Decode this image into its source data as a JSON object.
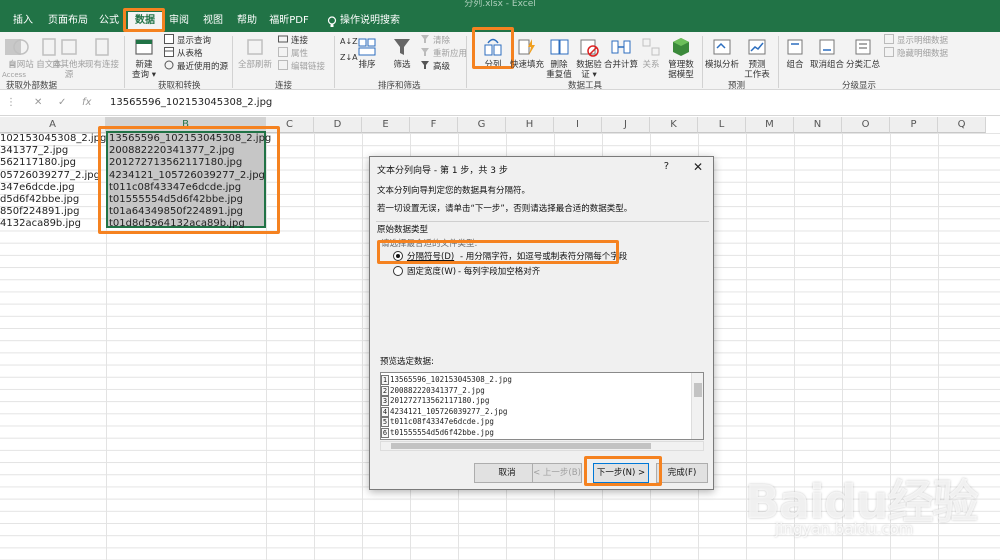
{
  "window": {
    "title": "分列.xlsx  -  Excel"
  },
  "tabs": [
    {
      "label": "插入"
    },
    {
      "label": "页面布局"
    },
    {
      "label": "公式"
    },
    {
      "label": "数据"
    },
    {
      "label": "审阅"
    },
    {
      "label": "视图"
    },
    {
      "label": "帮助"
    },
    {
      "label": "福昕PDF"
    },
    {
      "label": "操作说明搜索"
    }
  ],
  "ribbon": {
    "get_external": {
      "from_access": "自 Access",
      "from_web": "自网站",
      "from_text": "自文本",
      "from_other": "自其他来源",
      "existing": "现有连接",
      "group": "获取外部数据"
    },
    "get_transform": {
      "new_query": "新建",
      "new_query2": "查询 ▾",
      "show_queries": "显示查询",
      "from_table": "从表格",
      "recent": "最近使用的源",
      "group": "获取和转换"
    },
    "connections": {
      "refresh_all": "全部刷新",
      "connections": "连接",
      "properties": "属性",
      "edit_links": "编辑链接",
      "group": "连接"
    },
    "sort_filter": {
      "sort": "排序",
      "filter": "筛选",
      "clear": "清除",
      "reapply": "重新应用",
      "advanced": "高级",
      "group": "排序和筛选"
    },
    "data_tools": {
      "text_to_columns": "分列",
      "flash_fill": "快速填充",
      "remove_dup1": "删除",
      "remove_dup2": "重复值",
      "validation1": "数据验",
      "validation2": "证 ▾",
      "consolidate": "合并计算",
      "relationships": "关系",
      "data_model1": "管理数",
      "data_model2": "据模型",
      "group": "数据工具"
    },
    "forecast": {
      "what_if": "模拟分析",
      "forecast_sheet1": "预测",
      "forecast_sheet2": "工作表",
      "group": "预测"
    },
    "outline": {
      "group_btn": "组合",
      "ungroup": "取消组合",
      "subtotal": "分类汇总",
      "show_detail": "显示明细数据",
      "hide_detail": "隐藏明细数据",
      "group": "分级显示"
    }
  },
  "formula_bar": {
    "value": "13565596_102153045308_2.jpg"
  },
  "columns": [
    "A",
    "B",
    "C",
    "D",
    "E",
    "F",
    "G",
    "H",
    "I",
    "J",
    "K",
    "L",
    "M",
    "N",
    "O",
    "P",
    "Q"
  ],
  "col_a": [
    "102153045308_2.jpg",
    "341377_2.jpg",
    "562117180.jpg",
    "05726039277_2.jpg",
    "347e6dcde.jpg",
    "d5d6f42bbe.jpg",
    "850f224891.jpg",
    "4132aca89b.jpg"
  ],
  "col_b": [
    "13565596_102153045308_2.jpg",
    "200882220341377_2.jpg",
    "201272713562117180.jpg",
    "4234121_105726039277_2.jpg",
    "t011c08f43347e6dcde.jpg",
    "t01555554d5d6f42bbe.jpg",
    "t01a64349850f224891.jpg",
    "t01d8d5964132aca89b.jpg"
  ],
  "dialog": {
    "title": "文本分列向导 - 第 1 步，共 3 步",
    "help": "?",
    "close": "✕",
    "line1": "文本分列向导判定您的数据具有分隔符。",
    "line2": "若一切设置无误，请单击“下一步”，否则请选择最合适的数据类型。",
    "section": "原始数据类型",
    "prompt": "请选择最合适的文件类型:",
    "opt1_label": "分隔符号(D)",
    "opt1_desc": "- 用分隔字符，如逗号或制表符分隔每个字段",
    "opt2_label": "固定宽度(W)",
    "opt2_desc": "- 每列字段加空格对齐",
    "preview_label": "预览选定数据:",
    "preview_rows": [
      {
        "n": "1",
        "text": "13565596_102153045308_2.jpg"
      },
      {
        "n": "2",
        "text": "200882220341377_2.jpg"
      },
      {
        "n": "3",
        "text": "201272713562117180.jpg"
      },
      {
        "n": "4",
        "text": "4234121_105726039277_2.jpg"
      },
      {
        "n": "5",
        "text": "t011c08f43347e6dcde.jpg"
      },
      {
        "n": "6",
        "text": "t01555554d5d6f42bbe.jpg"
      }
    ],
    "cancel": "取消",
    "back": "< 上一步(B)",
    "next": "下一步(N) >",
    "finish": "完成(F)"
  },
  "watermark": {
    "logo": "Baidu经验",
    "url": "jingyan.baidu.com"
  },
  "colors": {
    "excel_green": "#217346",
    "highlight": "#f58220"
  }
}
